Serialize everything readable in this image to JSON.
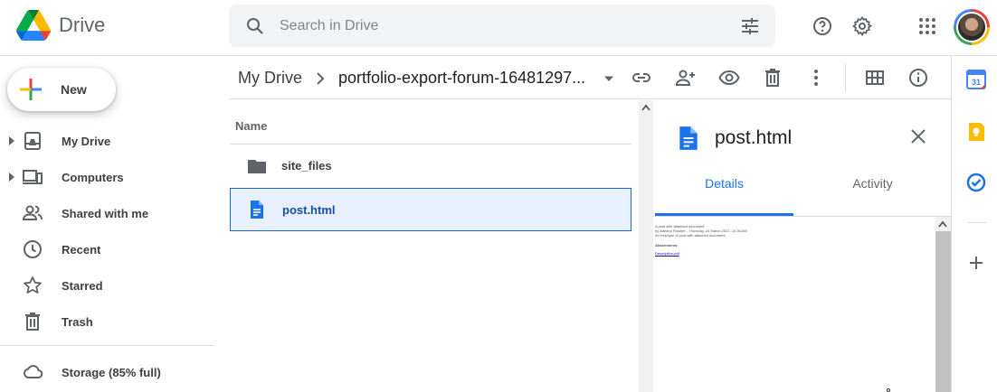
{
  "app": {
    "name": "Drive"
  },
  "search": {
    "placeholder": "Search in Drive",
    "value": ""
  },
  "sidebar": {
    "new_label": "New",
    "items": [
      {
        "label": "My Drive",
        "icon": "my-drive-icon",
        "expandable": true
      },
      {
        "label": "Computers",
        "icon": "computers-icon",
        "expandable": true
      },
      {
        "label": "Shared with me",
        "icon": "shared-icon",
        "expandable": false
      },
      {
        "label": "Recent",
        "icon": "clock-icon",
        "expandable": false
      },
      {
        "label": "Starred",
        "icon": "star-icon",
        "expandable": false
      },
      {
        "label": "Trash",
        "icon": "trash-icon",
        "expandable": false
      }
    ],
    "storage_label": "Storage (85% full)"
  },
  "breadcrumb": {
    "root": "My Drive",
    "current": "portfolio-export-forum-16481297..."
  },
  "list": {
    "column_name": "Name",
    "rows": [
      {
        "name": "site_files",
        "type": "folder",
        "selected": false
      },
      {
        "name": "post.html",
        "type": "document",
        "selected": true
      }
    ]
  },
  "details": {
    "title": "post.html",
    "tabs": [
      {
        "label": "Details",
        "active": true
      },
      {
        "label": "Activity",
        "active": false
      }
    ],
    "preview_lines": [
      "A post with attached document",
      "by Adriano Ruseler - Thursday, 24 March 2022, 10:36 AM",
      "An example of post with attached document",
      "Attachments:",
      "Description.pdf"
    ]
  },
  "colors": {
    "accent": "#1a73e8",
    "selected_bg": "#e8f0fe",
    "selected_border": "#1967d2",
    "text": "#202124",
    "muted": "#5f6368"
  }
}
